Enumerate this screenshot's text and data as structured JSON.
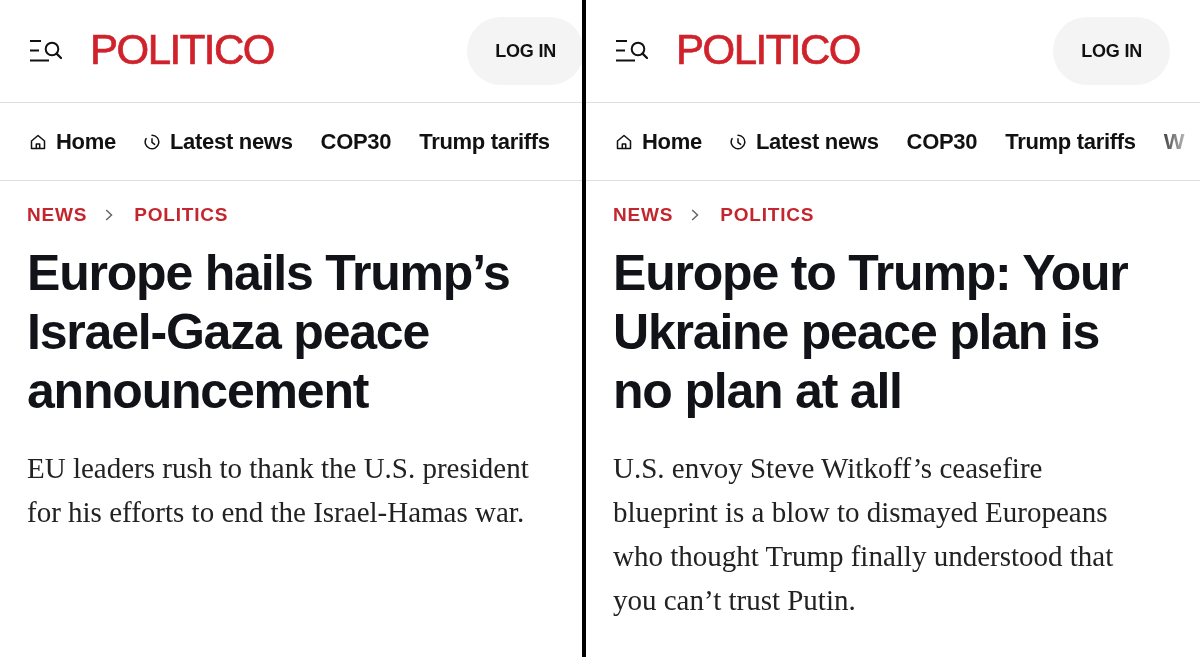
{
  "panels": [
    {
      "header": {
        "logo": "POLITICO",
        "login_button": "LOG IN"
      },
      "nav": [
        {
          "label": "Home",
          "kind": "home"
        },
        {
          "label": "Latest news",
          "kind": "clock"
        },
        {
          "label": "COP30",
          "kind": "plain"
        },
        {
          "label": "Trump tariffs",
          "kind": "plain"
        }
      ],
      "breadcrumb": [
        "NEWS",
        "POLITICS"
      ],
      "headline": "Europe hails Trump’s Israel-Gaza peace announcement",
      "summary": "EU leaders rush to thank the U.S. president for his efforts to end the Israel-Hamas war."
    },
    {
      "header": {
        "logo": "POLITICO",
        "login_button": "LOG IN"
      },
      "nav": [
        {
          "label": "Home",
          "kind": "home"
        },
        {
          "label": "Latest news",
          "kind": "clock"
        },
        {
          "label": "COP30",
          "kind": "plain"
        },
        {
          "label": "Trump tariffs",
          "kind": "plain"
        },
        {
          "label": "W",
          "kind": "plain"
        }
      ],
      "breadcrumb": [
        "NEWS",
        "POLITICS"
      ],
      "headline": "Europe to Trump: Your Ukraine peace plan is no plan at all",
      "summary": "U.S. envoy Steve Witkoff’s ceasefire blueprint is a blow to dismayed Europeans who thought Trump finally understood that you can’t trust Putin."
    }
  ]
}
